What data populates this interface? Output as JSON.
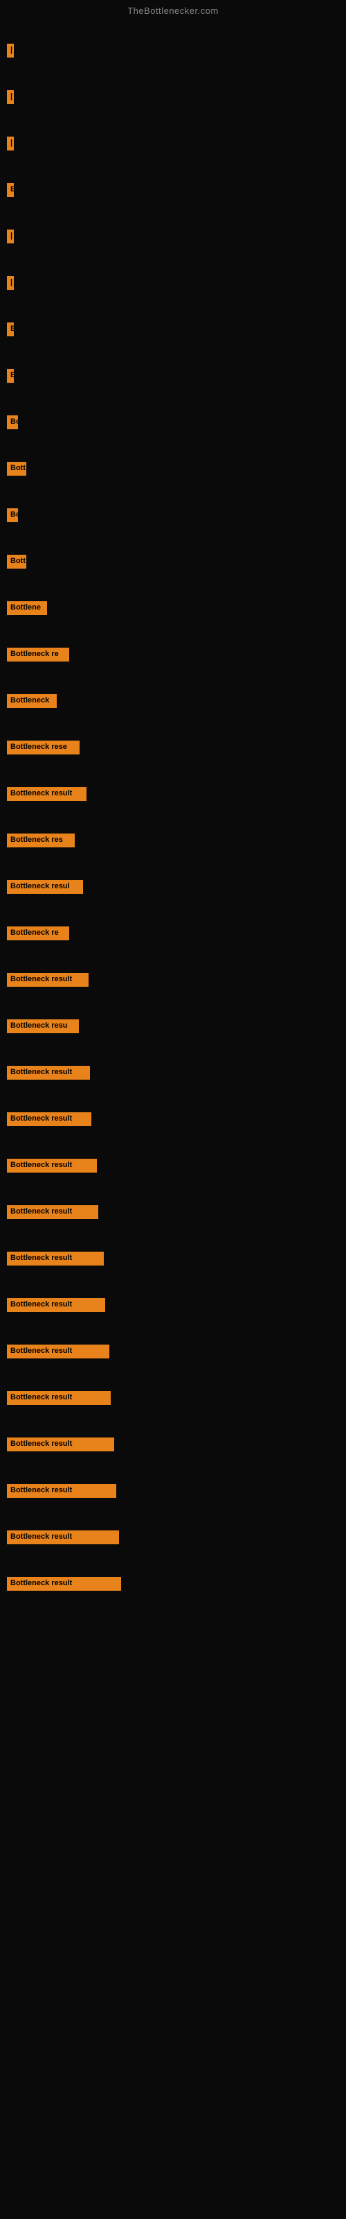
{
  "site": {
    "title": "TheBottlenecker.com"
  },
  "bars": [
    {
      "label": "|",
      "width": 4,
      "marginTop": 30
    },
    {
      "label": "|",
      "width": 4,
      "marginTop": 35
    },
    {
      "label": "|",
      "width": 4,
      "marginTop": 35
    },
    {
      "label": "E",
      "width": 8,
      "marginTop": 35
    },
    {
      "label": "|",
      "width": 4,
      "marginTop": 35
    },
    {
      "label": "|",
      "width": 4,
      "marginTop": 35
    },
    {
      "label": "E",
      "width": 8,
      "marginTop": 35
    },
    {
      "label": "B",
      "width": 10,
      "marginTop": 35
    },
    {
      "label": "Bo",
      "width": 16,
      "marginTop": 35
    },
    {
      "label": "Bott",
      "width": 28,
      "marginTop": 35
    },
    {
      "label": "Bo",
      "width": 16,
      "marginTop": 35
    },
    {
      "label": "Bott",
      "width": 28,
      "marginTop": 35
    },
    {
      "label": "Bottlene",
      "width": 58,
      "marginTop": 35
    },
    {
      "label": "Bottleneck re",
      "width": 90,
      "marginTop": 35
    },
    {
      "label": "Bottleneck",
      "width": 72,
      "marginTop": 35
    },
    {
      "label": "Bottleneck rese",
      "width": 105,
      "marginTop": 35
    },
    {
      "label": "Bottleneck result",
      "width": 115,
      "marginTop": 35
    },
    {
      "label": "Bottleneck res",
      "width": 98,
      "marginTop": 35
    },
    {
      "label": "Bottleneck resul",
      "width": 110,
      "marginTop": 35
    },
    {
      "label": "Bottleneck re",
      "width": 90,
      "marginTop": 35
    },
    {
      "label": "Bottleneck result",
      "width": 118,
      "marginTop": 35
    },
    {
      "label": "Bottleneck resu",
      "width": 104,
      "marginTop": 35
    },
    {
      "label": "Bottleneck result",
      "width": 120,
      "marginTop": 35
    },
    {
      "label": "Bottleneck result",
      "width": 122,
      "marginTop": 35
    },
    {
      "label": "Bottleneck result",
      "width": 130,
      "marginTop": 35
    },
    {
      "label": "Bottleneck result",
      "width": 132,
      "marginTop": 35
    },
    {
      "label": "Bottleneck result",
      "width": 140,
      "marginTop": 35
    },
    {
      "label": "Bottleneck result",
      "width": 142,
      "marginTop": 35
    },
    {
      "label": "Bottleneck result",
      "width": 148,
      "marginTop": 35
    },
    {
      "label": "Bottleneck result",
      "width": 150,
      "marginTop": 35
    },
    {
      "label": "Bottleneck result",
      "width": 155,
      "marginTop": 35
    },
    {
      "label": "Bottleneck result",
      "width": 158,
      "marginTop": 35
    },
    {
      "label": "Bottleneck result",
      "width": 162,
      "marginTop": 35
    },
    {
      "label": "Bottleneck result",
      "width": 165,
      "marginTop": 35
    }
  ]
}
